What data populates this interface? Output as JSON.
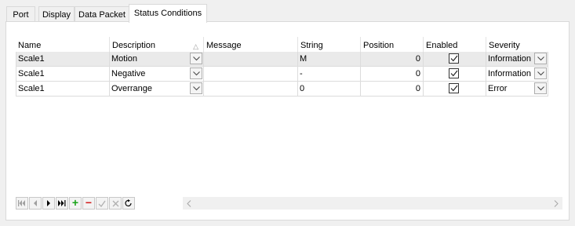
{
  "tabs": [
    {
      "label": "Port"
    },
    {
      "label": "Display"
    },
    {
      "label": "Data Packet"
    },
    {
      "label": "Status Conditions"
    }
  ],
  "active_tab": "Status Conditions",
  "grid": {
    "columns": {
      "name": "Name",
      "description": "Description",
      "message": "Message",
      "string": "String",
      "position": "Position",
      "enabled": "Enabled",
      "severity": "Severity"
    },
    "sort_indicator": "△",
    "rows": [
      {
        "name": "Scale1",
        "description": "Motion",
        "message": "",
        "string": "M",
        "position": "0",
        "enabled": true,
        "severity": "Information"
      },
      {
        "name": "Scale1",
        "description": "Negative",
        "message": "",
        "string": "-",
        "position": "0",
        "enabled": true,
        "severity": "Information"
      },
      {
        "name": "Scale1",
        "description": "Overrange",
        "message": "",
        "string": "0",
        "position": "0",
        "enabled": true,
        "severity": "Error"
      }
    ]
  },
  "navigator": {
    "buttons": [
      "first-icon",
      "prev-page-icon",
      "next-icon",
      "last-icon",
      "add-icon",
      "delete-icon",
      "post-icon",
      "cancel-icon",
      "refresh-icon"
    ],
    "add_symbol": "+",
    "delete_symbol": "−"
  },
  "colors": {
    "add": "#17a317",
    "delete": "#d21d1d",
    "selected_row": "#eaeaea"
  }
}
